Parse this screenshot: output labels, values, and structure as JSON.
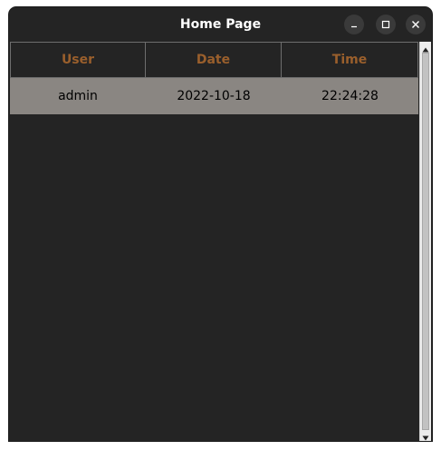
{
  "window": {
    "title": "Home Page"
  },
  "table": {
    "columns": [
      "User",
      "Date",
      "Time"
    ],
    "rows": [
      [
        "admin",
        "2022-10-18",
        "22:24:28"
      ]
    ]
  },
  "colors": {
    "window_bg": "#242424",
    "header_text": "#9a5f2c",
    "selected_row_bg": "#8a8682"
  }
}
